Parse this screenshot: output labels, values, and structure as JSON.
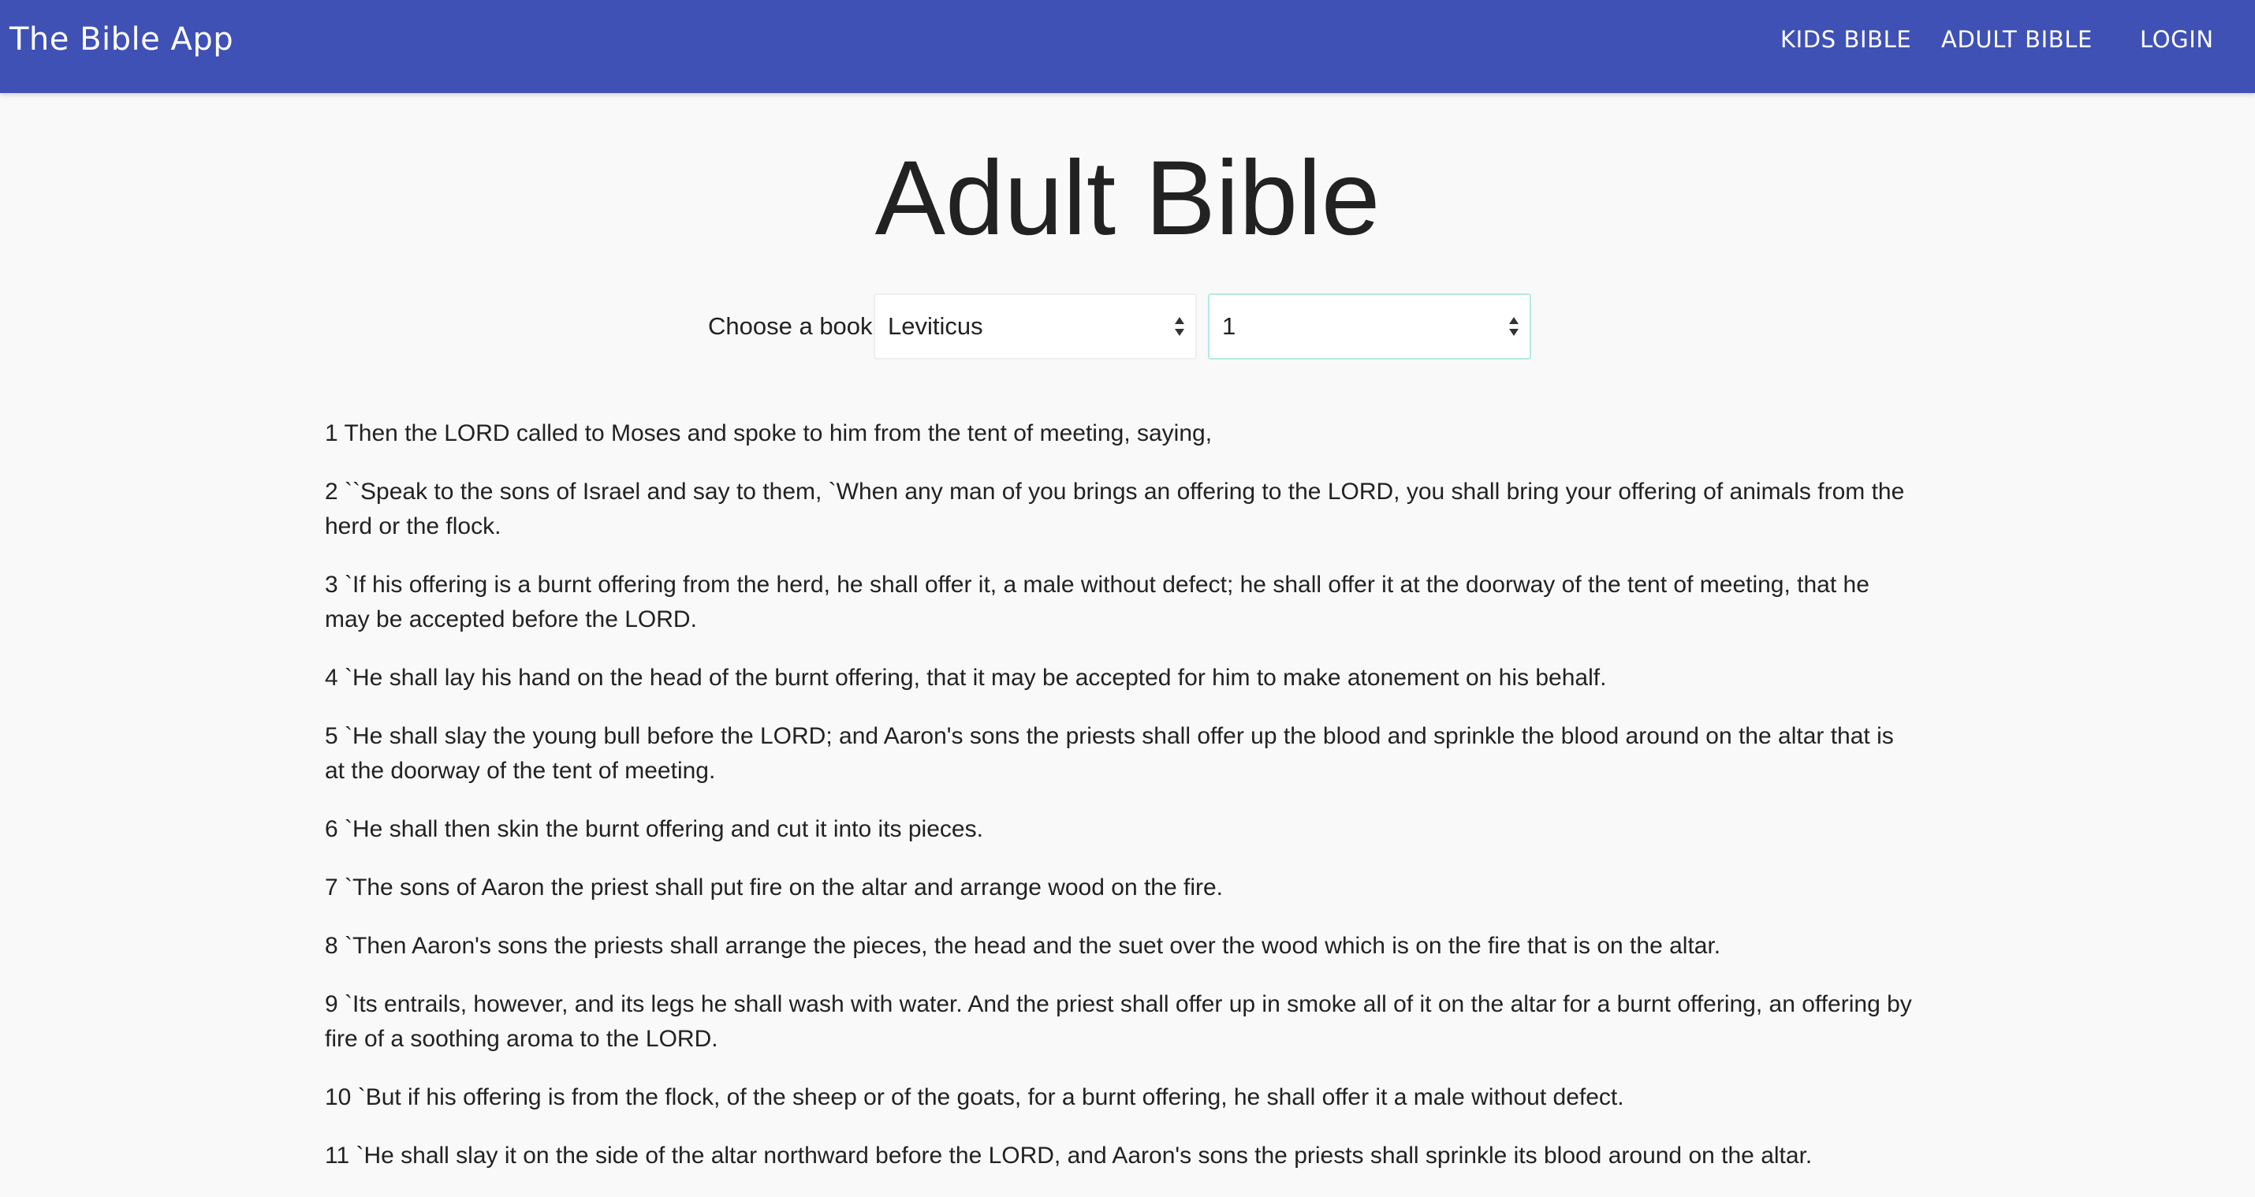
{
  "navbar": {
    "brand": "The Bible App",
    "links": [
      "Kids Bible",
      "Adult Bible",
      "Login"
    ]
  },
  "page": {
    "title": "Adult Bible"
  },
  "picker": {
    "label": "Choose a book",
    "book": "Leviticus",
    "chapter": "1"
  },
  "verses": [
    "1 Then the LORD called to Moses and spoke to him from the tent of meeting, saying,",
    "2 ``Speak to the sons of Israel and say to them, `When any man of you brings an offering to the LORD, you shall bring your offering of animals from the herd or the flock.",
    "3 `If his offering is a burnt offering from the herd, he shall offer it, a male without defect; he shall offer it at the doorway of the tent of meeting, that he may be accepted before the LORD.",
    "4 `He shall lay his hand on the head of the burnt offering, that it may be accepted for him to make atonement on his behalf.",
    "5 `He shall slay the young bull before the LORD; and Aaron's sons the priests shall offer up the blood and sprinkle the blood around on the altar that is at the doorway of the tent of meeting.",
    "6 `He shall then skin the burnt offering and cut it into its pieces.",
    "7 `The sons of Aaron the priest shall put fire on the altar and arrange wood on the fire.",
    "8 `Then Aaron's sons the priests shall arrange the pieces, the head and the suet over the wood which is on the fire that is on the altar.",
    "9 `Its entrails, however, and its legs he shall wash with water. And the priest shall offer up in smoke all of it on the altar for a burnt offering, an offering by fire of a soothing aroma to the LORD.",
    "10 `But if his offering is from the flock, of the sheep or of the goats, for a burnt offering, he shall offer it a male without defect.",
    "11 `He shall slay it on the side of the altar northward before the LORD, and Aaron's sons the priests shall sprinkle its blood around on the altar."
  ],
  "colors": {
    "navbar": "#3f51b5",
    "background": "#f9f9f9",
    "text": "#222222"
  },
  "icons": {
    "select_arrows": "up-down-caret-icon"
  }
}
